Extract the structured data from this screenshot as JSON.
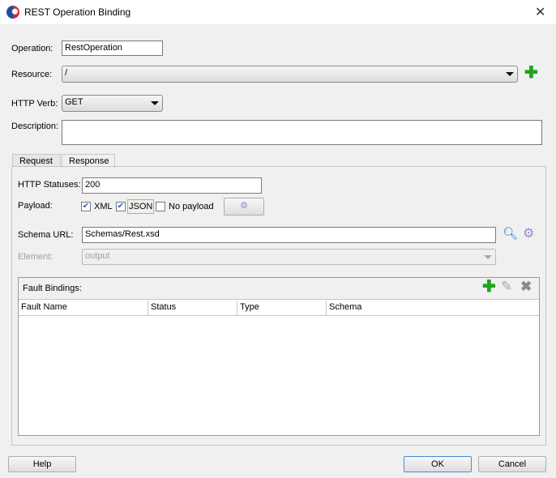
{
  "window": {
    "title": "REST Operation Binding"
  },
  "form": {
    "operation_label": "Operation:",
    "operation_value": "RestOperation",
    "resource_label": "Resource:",
    "resource_value": "/",
    "verb_label": "HTTP Verb:",
    "verb_value": "GET",
    "description_label": "Description:",
    "description_value": ""
  },
  "tabs": [
    {
      "label": "Request"
    },
    {
      "label": "Response"
    }
  ],
  "response": {
    "statuses_label": "HTTP Statuses:",
    "statuses_value": "200",
    "payload_label": "Payload:",
    "payload_options": [
      {
        "label": "XML",
        "checked": true
      },
      {
        "label": "JSON",
        "checked": true
      },
      {
        "label": "No payload",
        "checked": false
      }
    ],
    "schema_label": "Schema URL:",
    "schema_value": "Schemas/Rest.xsd",
    "element_label": "Element:",
    "element_value": "output",
    "fault_title": "Fault Bindings:",
    "columns": [
      "Fault Name",
      "Status",
      "Type",
      "Schema"
    ],
    "rows": []
  },
  "footer": {
    "help": "Help",
    "ok": "OK",
    "cancel": "Cancel"
  }
}
